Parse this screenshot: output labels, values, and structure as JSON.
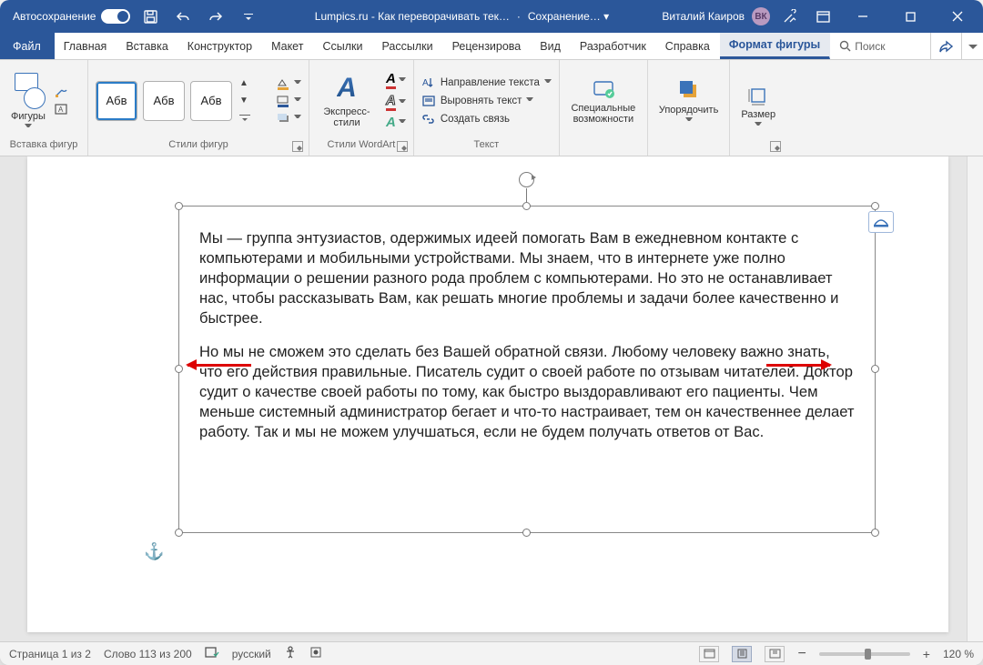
{
  "title": {
    "autosave": "Автосохранение",
    "doc": "Lumpics.ru - Как переворачивать тек…",
    "saving": "Сохранение… ▾",
    "user": "Виталий Каиров",
    "initials": "ВК"
  },
  "tabs": {
    "file": "Файл",
    "home": "Главная",
    "insert": "Вставка",
    "design": "Конструктор",
    "layout": "Макет",
    "refs": "Ссылки",
    "mail": "Рассылки",
    "review": "Рецензирова",
    "view": "Вид",
    "dev": "Разработчик",
    "help": "Справка",
    "format": "Формат фигуры",
    "search": "Поиск"
  },
  "ribbon": {
    "shapes": "Фигуры",
    "shapes_group": "Вставка фигур",
    "style_sample": "Абв",
    "styles_group": "Стили фигур",
    "wordart": "Экспресс-стили",
    "wordart_group": "Стили WordArt",
    "text_dir": "Направление текста",
    "align_text": "Выровнять текст",
    "link": "Создать связь",
    "text_group": "Текст",
    "acc": "Специальные возможности",
    "arrange": "Упорядочить",
    "size": "Размер"
  },
  "content": {
    "p1": "Мы — группа энтузиастов, одержимых идеей помогать Вам в ежедневном контакте с компьютерами и мобильными устройствами. Мы знаем, что в интернете уже полно информации о решении разного рода проблем с компьютерами. Но это не останавливает нас, чтобы рассказывать Вам, как решать многие проблемы и задачи более качественно и быстрее.",
    "p2": "Но мы не сможем это сделать без Вашей обратной связи. Любому человеку важно знать, что его действия правильные. Писатель судит о своей работе по отзывам читателей. Доктор судит о качестве своей работы по тому, как быстро выздоравливают его пациенты. Чем меньше системный администратор бегает и что-то настраивает, тем он качественнее делает работу. Так и мы не можем улучшаться, если не будем получать ответов от Вас."
  },
  "status": {
    "page": "Страница 1 из 2",
    "words": "Слово 113 из 200",
    "lang": "русский",
    "zoom": "120 %"
  }
}
